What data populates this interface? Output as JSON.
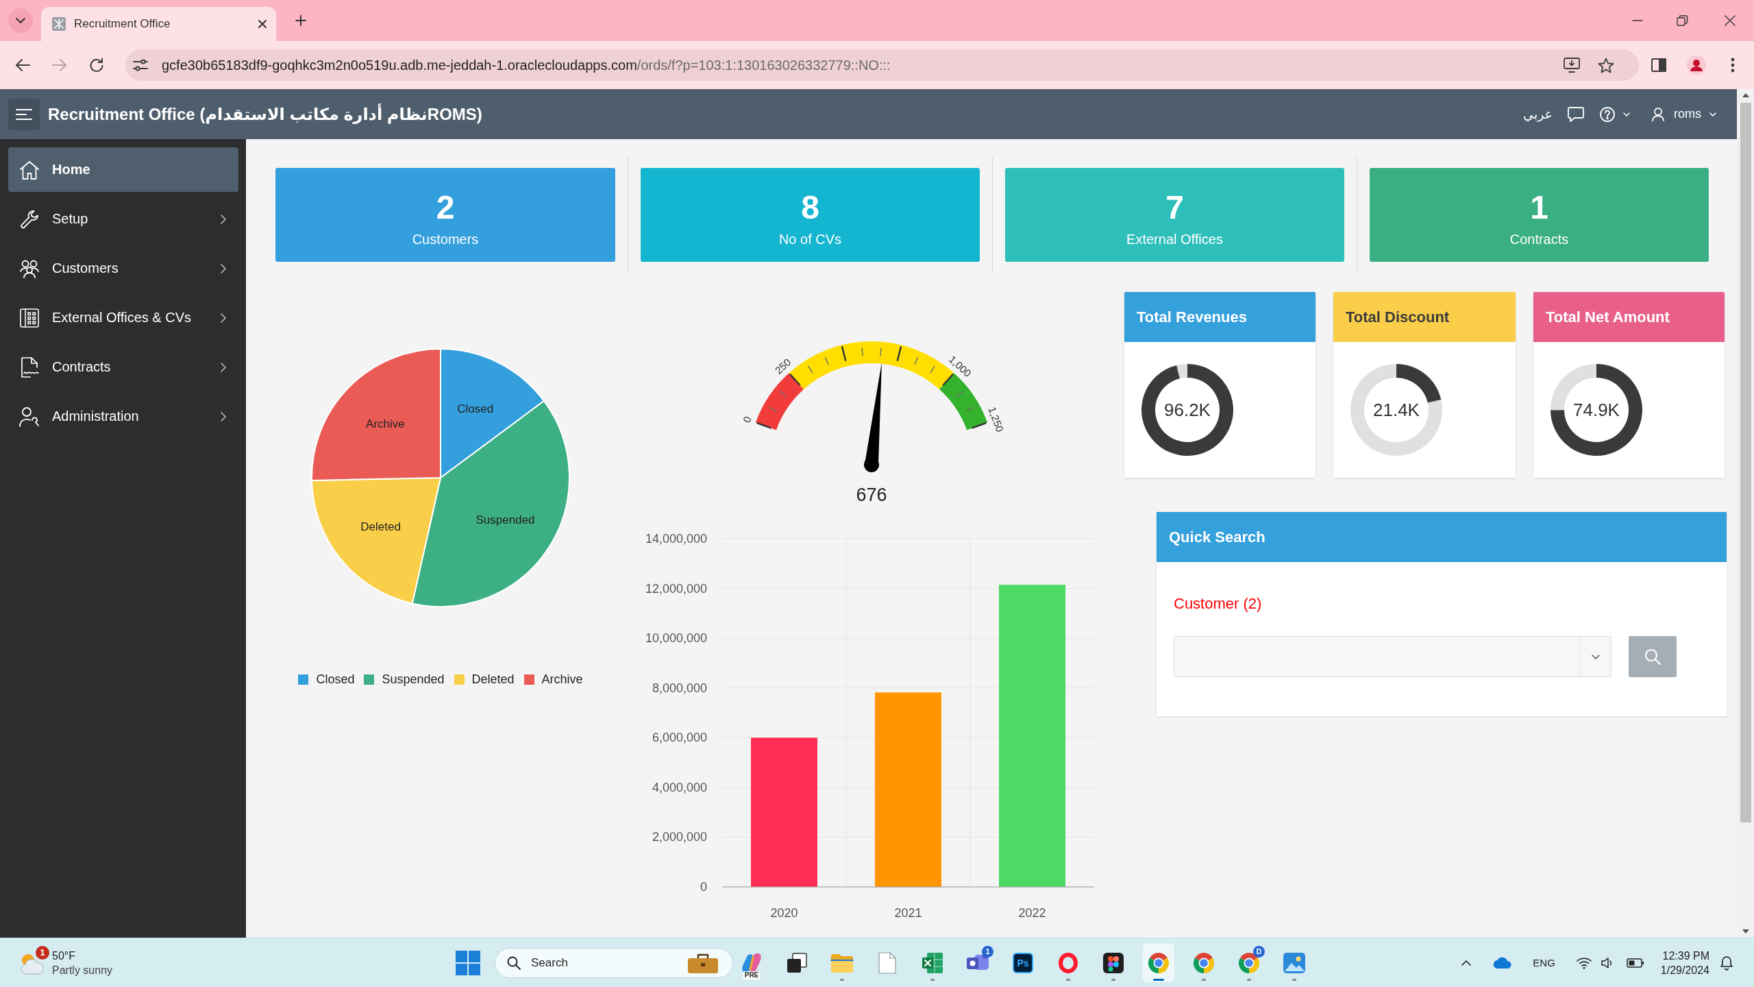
{
  "browser": {
    "tab": {
      "title": "Recruitment Office"
    },
    "nav": [
      {
        "kind": "back",
        "disabled": false
      },
      {
        "kind": "forward",
        "disabled": true
      },
      {
        "kind": "reload",
        "disabled": false
      }
    ],
    "address": {
      "host": "gcfe30b65183df9-goqhkc3m2n0o519u.adb.me-jeddah-1.oraclecloudapps.com",
      "path": "/ords/f?p=103:1:130163026332779::NO:::"
    }
  },
  "header": {
    "title": "Recruitment Office (نظام أدارة مكاتب الاستقدامROMS)",
    "language": "عربي",
    "user": "roms"
  },
  "sidebar": {
    "items": [
      {
        "kind": "home",
        "label": "Home",
        "selected": true,
        "expandable": false
      },
      {
        "kind": "setup",
        "label": "Setup",
        "selected": false,
        "expandable": true
      },
      {
        "kind": "customers",
        "label": "Customers",
        "selected": false,
        "expandable": true
      },
      {
        "kind": "offices",
        "label": "External Offices & CVs",
        "selected": false,
        "expandable": true
      },
      {
        "kind": "contracts",
        "label": "Contracts",
        "selected": false,
        "expandable": true
      },
      {
        "kind": "administration",
        "label": "Administration",
        "selected": false,
        "expandable": true
      }
    ]
  },
  "stats": [
    {
      "value": "2",
      "label": "Customers",
      "color": "#339fdd"
    },
    {
      "value": "8",
      "label": "No of CVs",
      "color": "#14b5d0"
    },
    {
      "value": "7",
      "label": "External Offices",
      "color": "#2ebfbb"
    },
    {
      "value": "1",
      "label": "Contracts",
      "color": "#3aaf84"
    }
  ],
  "pie": {
    "slices": [
      {
        "label": "Closed",
        "color": "#339fdd"
      },
      {
        "label": "Suspended",
        "color": "#3daf85"
      },
      {
        "label": "Deleted",
        "color": "#f9ce49"
      },
      {
        "label": "Archive",
        "color": "#e95b54"
      }
    ],
    "legend": [
      {
        "label": "Closed",
        "color": "#339fdd"
      },
      {
        "label": "Suspended",
        "color": "#3daf85"
      },
      {
        "label": "Deleted",
        "color": "#f9ce49"
      },
      {
        "label": "Archive",
        "color": "#e95b54"
      }
    ]
  },
  "gauge": {
    "value": "676",
    "level": 0.5408,
    "ticks": [
      "0",
      "250",
      "1,000",
      "1,250"
    ],
    "bands": [
      {
        "color": "#f23c3c"
      },
      {
        "color": "#ffde00"
      },
      {
        "color": "#34b22e"
      }
    ]
  },
  "bar_chart": {
    "chart_data": {
      "type": "bar",
      "categories": [
        "2020",
        "2021",
        "2022"
      ],
      "values": [
        6000000,
        7820000,
        12150000
      ],
      "colors": [
        "#ff2d55",
        "#ff9500",
        "#4cd964"
      ],
      "ylim": [
        0,
        14000000
      ],
      "grid": true,
      "yticks": [
        {
          "value": 0,
          "label": "0"
        },
        {
          "value": 2000000,
          "label": "2,000,000"
        },
        {
          "value": 4000000,
          "label": "4,000,000"
        },
        {
          "value": 6000000,
          "label": "6,000,000"
        },
        {
          "value": 8000000,
          "label": "8,000,000"
        },
        {
          "value": 10000000,
          "label": "10,000,000"
        },
        {
          "value": 12000000,
          "label": "12,000,000"
        },
        {
          "value": 14000000,
          "label": "14,000,000"
        }
      ]
    }
  },
  "kpis": [
    {
      "title": "Total Revenues",
      "value": "96.2K",
      "color": "#34a0dc"
    },
    {
      "title": "Total Discount",
      "value": "21.4K",
      "color": "#fbce4a"
    },
    {
      "title": "Total Net Amount",
      "value": "74.9K",
      "color": "#e8608a"
    }
  ],
  "quick_search": {
    "title": "Quick Search",
    "field_label": "Customer (2)"
  },
  "taskbar": {
    "weather": {
      "badge": "1",
      "temperature": "50°F",
      "condition": "Partly sunny"
    },
    "search": {
      "placeholder": "Search"
    },
    "apps": [
      {
        "kind": "copilot",
        "badge": "PRE",
        "running": false,
        "selected": false
      },
      {
        "kind": "taskview",
        "running": false,
        "selected": false
      },
      {
        "kind": "folder",
        "running": true,
        "selected": false
      },
      {
        "kind": "document",
        "running": false,
        "selected": false
      },
      {
        "kind": "spreadsheet",
        "running": true,
        "selected": false
      },
      {
        "kind": "teams",
        "badge": "1",
        "running": false,
        "selected": false
      },
      {
        "kind": "tile",
        "label": "Ps",
        "running": false,
        "selected": false
      },
      {
        "kind": "ring",
        "running": true,
        "selected": false
      },
      {
        "kind": "shapes",
        "running": true,
        "selected": false
      },
      {
        "kind": "round",
        "running": true,
        "selected": true
      },
      {
        "kind": "round",
        "running": true,
        "selected": false
      },
      {
        "kind": "round",
        "badge": "D",
        "running": true,
        "selected": false
      },
      {
        "kind": "picture",
        "running": true,
        "selected": false
      }
    ],
    "tray": {
      "language": "ENG",
      "time": "12:39 PM",
      "date": "1/29/2024"
    }
  }
}
